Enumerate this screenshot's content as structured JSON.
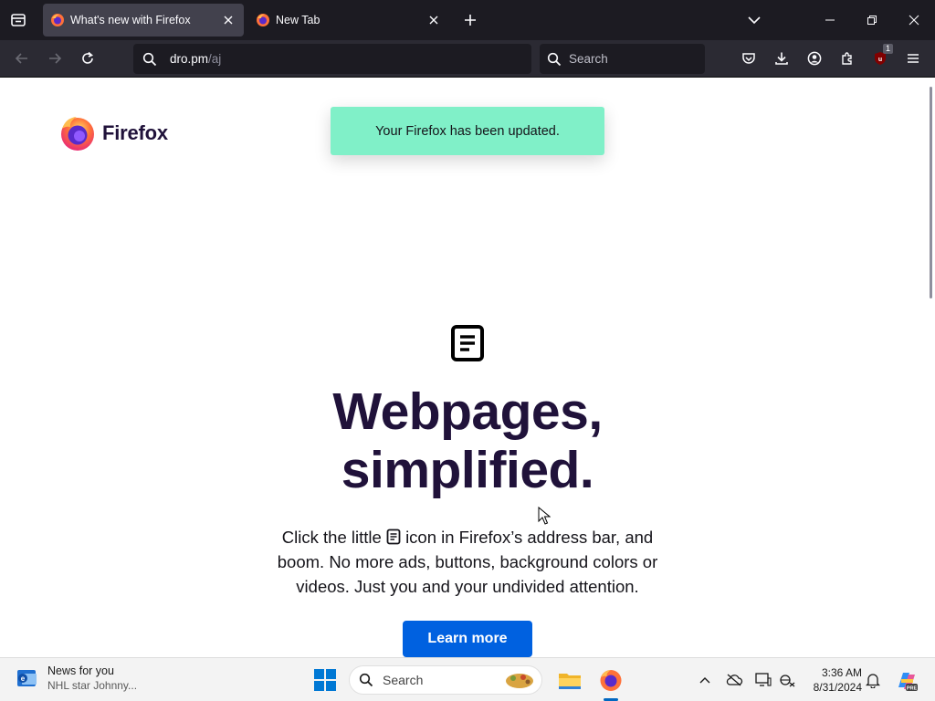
{
  "tabs": [
    {
      "title": "What's new with Firefox",
      "active": true
    },
    {
      "title": "New Tab",
      "active": false
    }
  ],
  "address_bar": {
    "host": "dro.pm",
    "path": "/aj"
  },
  "search_bar": {
    "placeholder": "Search"
  },
  "toolbar": {
    "extension_badge": "1"
  },
  "page": {
    "brand_name": "Firefox",
    "toast": "Your Firefox has been updated.",
    "title_line1": "Webpages,",
    "title_line2": "simplified.",
    "body_part1": "Click the little",
    "body_part2": "icon in Firefox’s address bar, and boom. No more ads, buttons, background colors or videos. Just you and your undivided attention.",
    "cta": "Learn more"
  },
  "taskbar": {
    "news_title": "News for you",
    "news_subtitle": "NHL star Johnny...",
    "search_label": "Search",
    "time": "3:36 AM",
    "date": "8/31/2024"
  },
  "colors": {
    "chrome_dark": "#1c1b22",
    "toolbar": "#2b2a33",
    "toast_bg": "#80f0c8",
    "title": "#20123a",
    "cta_bg": "#0061e0"
  },
  "icons": {
    "tab_list": "tab-list-icon",
    "reader_view": "reader-view-icon",
    "pocket": "pocket-icon",
    "download": "download-icon",
    "account": "account-icon",
    "extensions": "puzzle-icon",
    "ublock": "ublock-icon",
    "menu": "hamburger-icon"
  }
}
